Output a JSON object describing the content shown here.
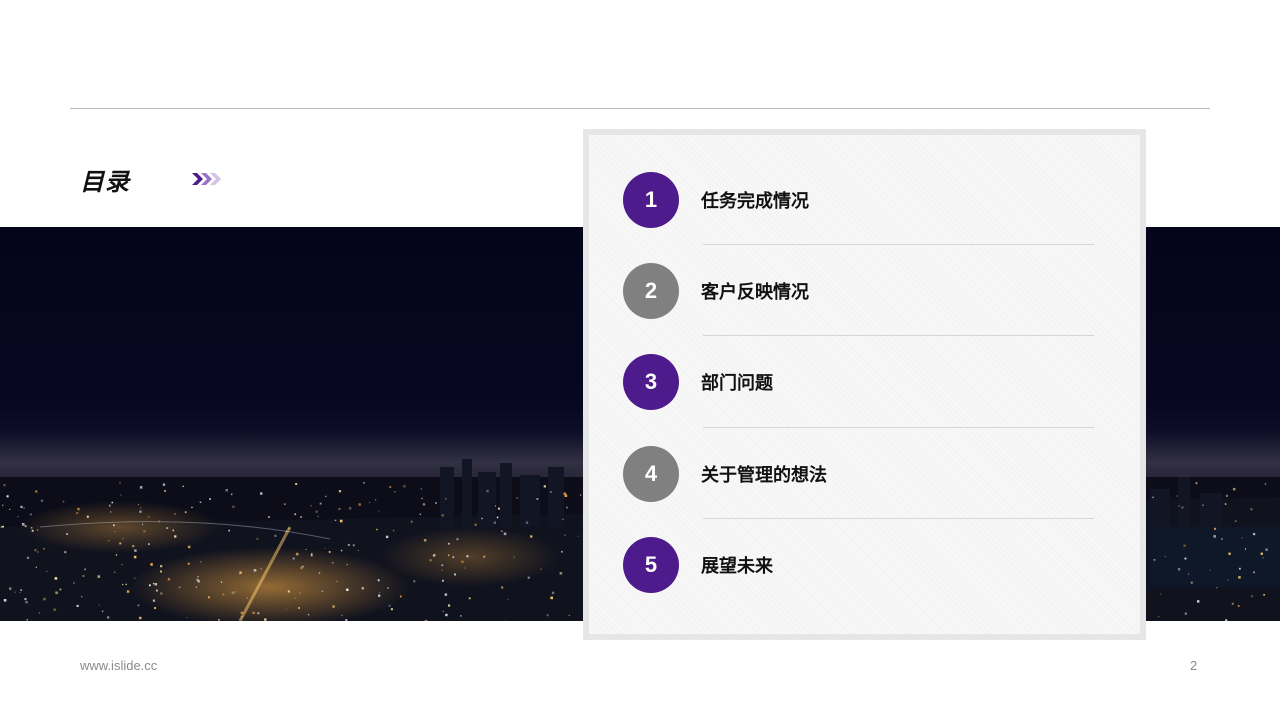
{
  "slide": {
    "title": "目录",
    "footer_url": "www.islide.cc",
    "page_number": "2"
  },
  "colors": {
    "accent_purple": "#4e1b8c",
    "gray": "#808080"
  },
  "toc": {
    "items": [
      {
        "number": "1",
        "label": "任务完成情况",
        "style": "purple"
      },
      {
        "number": "2",
        "label": "客户反映情况",
        "style": "gray"
      },
      {
        "number": "3",
        "label": "部门问题",
        "style": "purple"
      },
      {
        "number": "4",
        "label": "关于管理的想法",
        "style": "gray"
      },
      {
        "number": "5",
        "label": "展望未来",
        "style": "purple"
      }
    ]
  },
  "icons": {
    "title_decoration": "chevrons-right-icon"
  }
}
